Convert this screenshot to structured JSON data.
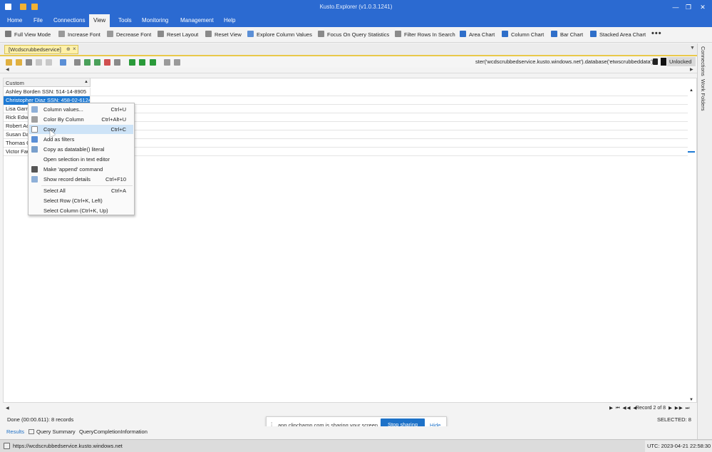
{
  "window": {
    "title": "Kusto.Explorer (v1.0.3.1241)"
  },
  "menu": [
    "Home",
    "File",
    "Connections",
    "View",
    "Tools",
    "Monitoring",
    "Management",
    "Help"
  ],
  "ribbon": {
    "buttons": [
      "Full View Mode",
      "Increase Font",
      "Decrease Font",
      "Reset Layout",
      "Reset View",
      "Explore Column Values",
      "Focus On Query Statistics",
      "Filter Rows In Search",
      "Area Chart",
      "Column Chart",
      "Bar Chart",
      "Stacked Area Chart"
    ],
    "more": "•••"
  },
  "doc_tab": {
    "label": "[Wcdscrubbedservice]",
    "pin": "⊕",
    "close": "×"
  },
  "query_toolbar": {
    "connection": "ster('wcdscrubbedservice.kusto.windows.net').database('etwscrubbeddata')",
    "lock_status": "Unlocked"
  },
  "grid": {
    "column_header": "Custom",
    "rows": [
      {
        "text": "Ashley Borden SSN: 514-14-8905",
        "selected": false
      },
      {
        "text": "Christopher Diaz SSN: 458-02-6124",
        "selected": true
      },
      {
        "text": "Lisa Garri",
        "selected": false
      },
      {
        "text": "Rick Edwa",
        "selected": false
      },
      {
        "text": "Robert Ac",
        "selected": false
      },
      {
        "text": "Susan Da",
        "selected": false
      },
      {
        "text": "Thomas C",
        "selected": false
      },
      {
        "text": "Victor Fau",
        "selected": false
      }
    ]
  },
  "context_menu": {
    "items": [
      {
        "label": "Column values...",
        "shortcut": "Ctrl+U"
      },
      {
        "label": "Color By Column",
        "shortcut": "Ctrl+Alt+U"
      },
      {
        "label": "Copy",
        "shortcut": "Ctrl+C"
      },
      {
        "label": "Add as filters",
        "shortcut": ""
      },
      {
        "label": "Copy as datatable() literal",
        "shortcut": ""
      },
      {
        "label": "Open selection in text editor",
        "shortcut": ""
      },
      {
        "label": "Make 'append' command",
        "shortcut": ""
      },
      {
        "label": "Show record details",
        "shortcut": "Ctrl+F10"
      },
      {
        "label": "Select All",
        "shortcut": "Ctrl+A"
      },
      {
        "label": "Select Row (Ctrl+K, Left)",
        "shortcut": ""
      },
      {
        "label": "Select Column (Ctrl+K, Up)",
        "shortcut": ""
      }
    ]
  },
  "pager": {
    "record": "Record 2 of 8"
  },
  "status": {
    "done": "Done (00:00.611): 8 records",
    "selected": "SELECTED: 8"
  },
  "share_bar": {
    "message": "app.clipchamp.com is sharing your screen.",
    "stop": "Stop sharing",
    "hide": "Hide"
  },
  "bottom_tabs": [
    "Results",
    "Query Summary",
    "QueryCompletionInformation"
  ],
  "footer": {
    "url": "https://wcdscrubbedservice.kusto.windows.net",
    "utc": "UTC: 2023-04-21 22:58:30"
  },
  "right_panel": [
    "Connections",
    "Work Folders"
  ],
  "colors": {
    "accent": "#2b6ad1",
    "selection": "#1e7ad4",
    "tab_yellow": "#fff1a8"
  }
}
